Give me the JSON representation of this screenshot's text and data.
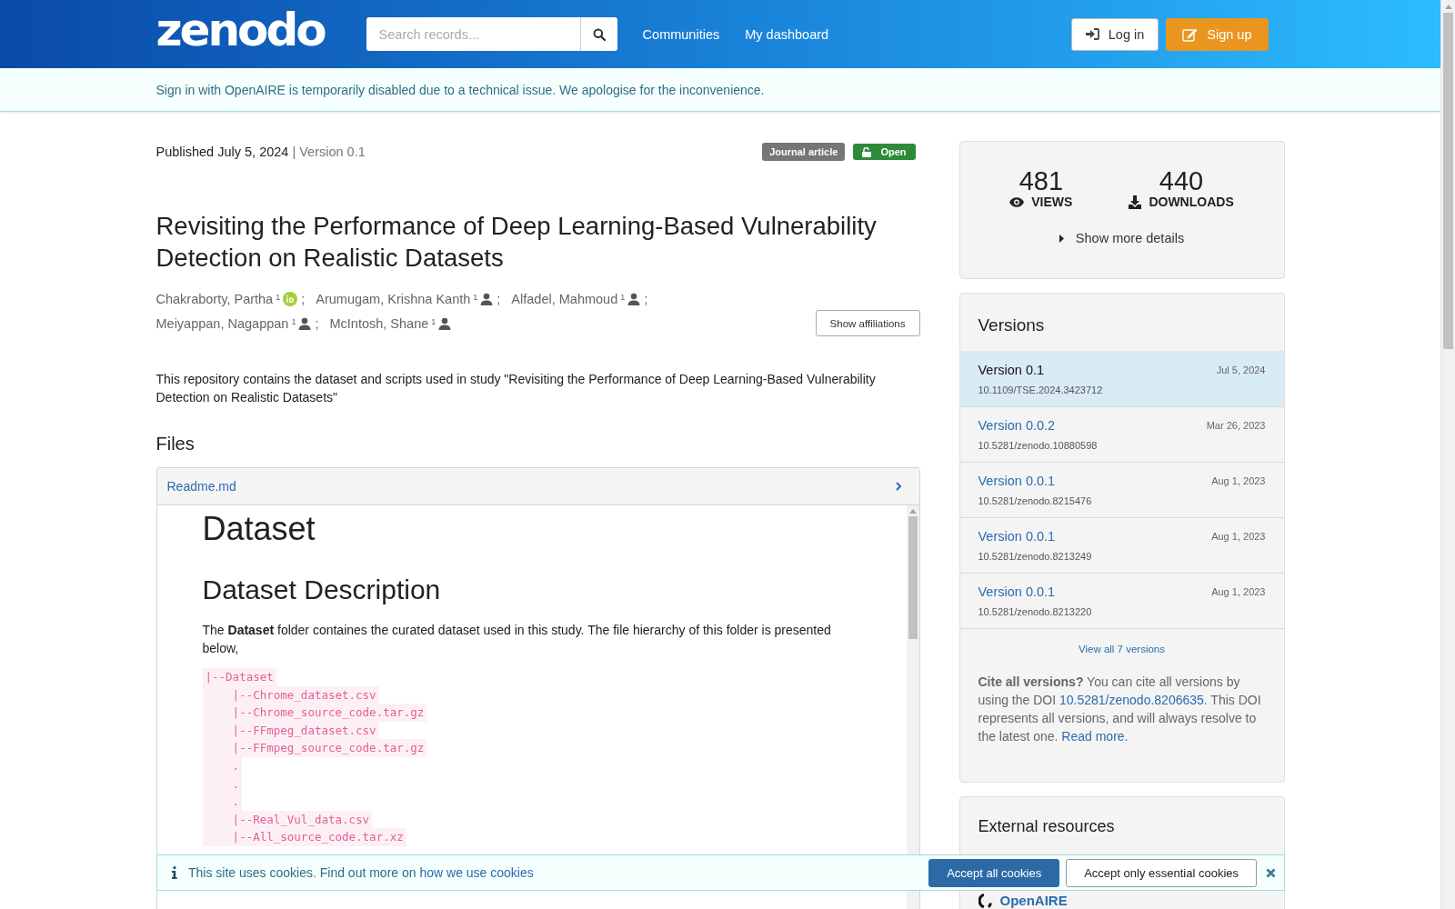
{
  "header": {
    "logo": "zenodo",
    "search": {
      "placeholder": "Search records..."
    },
    "nav": [
      {
        "label": "Communities"
      },
      {
        "label": "My dashboard"
      }
    ],
    "login": "Log in",
    "signup": "Sign up"
  },
  "notice": "Sign in with OpenAIRE is temporarily disabled due to a technical issue. We apologise for the inconvenience.",
  "record": {
    "published": "Published July 5, 2024",
    "version": "| Version 0.1",
    "badges": [
      {
        "label": "Journal article",
        "kind": "type"
      },
      {
        "label": "Open",
        "kind": "access"
      }
    ],
    "title": "Revisiting the Performance of Deep Learning-Based Vulnerability Detection on Realistic Datasets",
    "creator_lines": [
      {
        "creators": [
          {
            "name": "Chakraborty, Partha",
            "sup": "1",
            "kind": "orcid",
            "separator": ";"
          },
          {
            "name": "Arumugam, Krishna Kanth",
            "sup": "1",
            "kind": "person",
            "separator": ";"
          },
          {
            "name": "Alfadel, Mahmoud",
            "sup": "1",
            "kind": "person",
            "separator": ";"
          }
        ]
      },
      {
        "creators": [
          {
            "name": "Meiyappan, Nagappan",
            "sup": "1",
            "kind": "person",
            "separator": ";"
          },
          {
            "name": "McIntosh, Shane",
            "sup": "1",
            "kind": "person"
          }
        ]
      }
    ],
    "affiliations_button": "Show affiliations",
    "description": "This repository contains the dataset and scripts used in study \"Revisiting the Performance of Deep Learning-Based Vulnerability Detection on Realistic Datasets\""
  },
  "files": {
    "heading": "Files",
    "file": "Readme.md",
    "preview": {
      "h1": "Dataset",
      "h2": "Dataset Description",
      "paragraph": "The **Dataset** folder containes the curated dataset used in this study. The file hierarchy of this folder is presented below,",
      "code": [
        "|--Dataset",
        "    |--Chrome_dataset.csv",
        "    |--Chrome_source_code.tar.gz",
        "    |--FFmpeg_dataset.csv",
        "    |--FFmpeg_source_code.tar.gz",
        "    .",
        "    .",
        "    .",
        "    |--Real_Vul_data.csv",
        "    |--All_source_code.tar.xz"
      ]
    }
  },
  "stats": {
    "items": [
      {
        "value": "481",
        "label": "VIEWS",
        "kind": "views"
      },
      {
        "value": "440",
        "label": "DOWNLOADS",
        "kind": "downloads"
      }
    ],
    "more": "Show more details"
  },
  "versions": {
    "title": "Versions",
    "items": [
      {
        "label": "Version 0.1",
        "date": "Jul 5, 2024",
        "doi": "10.1109/TSE.2024.3423712",
        "selected": true
      },
      {
        "label": "Version 0.0.2",
        "date": "Mar 26, 2023",
        "doi": "10.5281/zenodo.10880598",
        "selected": false
      },
      {
        "label": "Version 0.0.1",
        "date": "Aug 1, 2023",
        "doi": "10.5281/zenodo.8215476",
        "selected": false
      },
      {
        "label": "Version 0.0.1",
        "date": "Aug 1, 2023",
        "doi": "10.5281/zenodo.8213249",
        "selected": false
      },
      {
        "label": "Version 0.0.1",
        "date": "Aug 1, 2023",
        "doi": "10.5281/zenodo.8213220",
        "selected": false
      }
    ],
    "view_all": "View all 7 versions",
    "cite": [
      {
        "kind": "bold",
        "text": "Cite all versions?"
      },
      {
        "kind": "text",
        "text": " You can cite all versions by using the DOI "
      },
      {
        "kind": "link",
        "text": "10.5281/zenodo.8206635"
      },
      {
        "kind": "text",
        "text": ". This DOI represents all versions, and will always resolve to the latest one. "
      },
      {
        "kind": "link",
        "text": "Read more"
      },
      {
        "kind": "text",
        "text": "."
      }
    ]
  },
  "external": {
    "title": "External resources",
    "items": [
      {
        "name": "OpenAIRE"
      }
    ]
  },
  "cookies": {
    "text": "This site uses cookies. Find out more on ",
    "link": "how we use cookies",
    "accept_all": "Accept all cookies",
    "accept_essential": "Accept only essential cookies"
  }
}
